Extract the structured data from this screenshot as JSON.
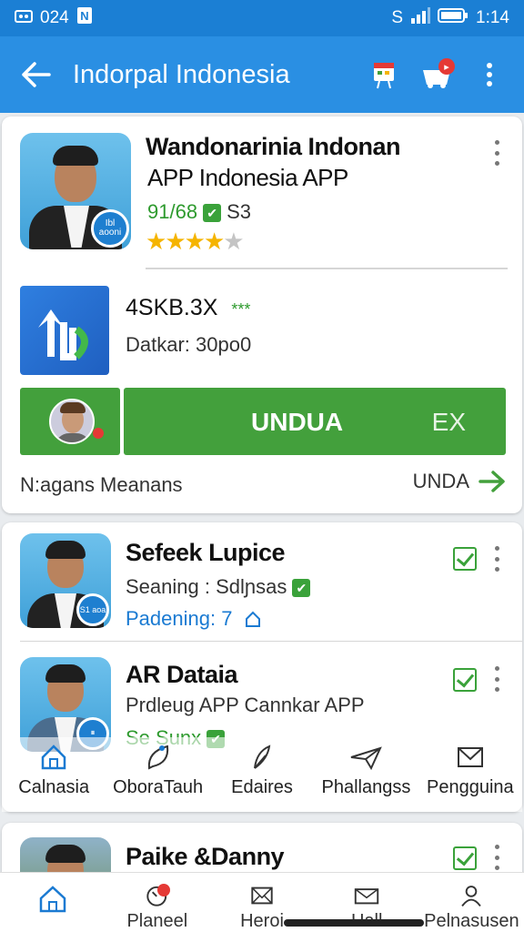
{
  "status_bar": {
    "left_text": "024",
    "time": "1:14",
    "s_label": "S"
  },
  "app_bar": {
    "title": "Indorpal Indonesia"
  },
  "featured": {
    "name_line1": "Wandonarinia Indonan",
    "name_line2": "APP Indonesia APP",
    "code": "91/68",
    "num": "S3",
    "rating_stars": 4,
    "rating_max": 5,
    "avatar_badge": "Ibl aooni",
    "app_size": "4SKB.3X",
    "app_stars": "***",
    "app_detail": "Datkar: 30po0",
    "download_label": "UNDUA",
    "download_ext": "EX",
    "footer_left": "N:agans Meanans",
    "footer_right": "UNDA"
  },
  "list": [
    {
      "name": "Sefeek Lupice",
      "line1_prefix": "Seaning : Sdlɲsas",
      "line2": "Padening: 7",
      "avatar_badge": "S1 aoa"
    },
    {
      "name": "AR Dataia",
      "line1_prefix": "Prdleug APP Cannkar APP",
      "line2": "Se Sunx"
    },
    {
      "name": "Paike &Danny"
    }
  ],
  "tabs": [
    {
      "label": "Calnasia",
      "icon": "home-icon"
    },
    {
      "label": "OboraTauh",
      "icon": "leaf-icon"
    },
    {
      "label": "Edaires",
      "icon": "feather-icon"
    },
    {
      "label": "Phallangss",
      "icon": "plane-icon"
    },
    {
      "label": "Pengguina",
      "icon": "mail-icon"
    }
  ],
  "bottom_nav": [
    {
      "label": "",
      "icon": "home-icon"
    },
    {
      "label": "Planeel",
      "icon": "timer-icon"
    },
    {
      "label": "Heroi",
      "icon": "mail-icon"
    },
    {
      "label": "Hall",
      "icon": "envelope-icon"
    },
    {
      "label": "Pelnasusen",
      "icon": "user-icon"
    }
  ],
  "colors": {
    "primary": "#2a8fe3",
    "accent": "#43a03c",
    "star": "#f5b400"
  }
}
